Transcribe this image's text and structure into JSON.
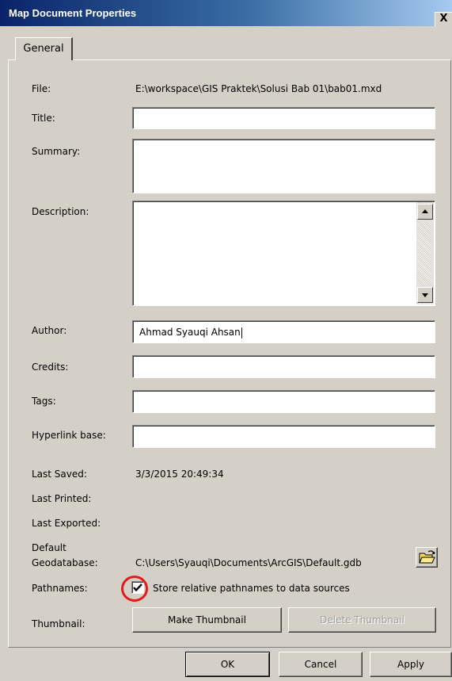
{
  "window": {
    "title": "Map Document Properties",
    "close_label": "X"
  },
  "tabs": [
    {
      "label": "General"
    }
  ],
  "form": {
    "file_label": "File:",
    "file_value": "E:\\workspace\\GIS Praktek\\Solusi Bab 01\\bab01.mxd",
    "title_label": "Title:",
    "title_value": "",
    "summary_label": "Summary:",
    "summary_value": "",
    "description_label": "Description:",
    "description_value": "",
    "author_label": "Author:",
    "author_value": "Ahmad Syauqi Ahsan",
    "credits_label": "Credits:",
    "credits_value": "",
    "tags_label": "Tags:",
    "tags_value": "",
    "hyperlink_label": "Hyperlink base:",
    "hyperlink_value": "",
    "last_saved_label": "Last Saved:",
    "last_saved_value": "3/3/2015 20:49:34",
    "last_printed_label": "Last Printed:",
    "last_exported_label": "Last Exported:",
    "default_gdb_label_line1": "Default",
    "default_gdb_label_line2": "Geodatabase:",
    "default_gdb_value": "C:\\Users\\Syauqi\\Documents\\ArcGIS\\Default.gdb",
    "pathnames_label": "Pathnames:",
    "pathnames_checkbox_label": "Store relative pathnames to data sources",
    "pathnames_checked": true,
    "thumbnail_label": "Thumbnail:",
    "make_thumbnail_label": "Make Thumbnail",
    "delete_thumbnail_label": "Delete Thumbnail"
  },
  "footer": {
    "ok_label": "OK",
    "cancel_label": "Cancel",
    "apply_label": "Apply"
  },
  "colors": {
    "titlebar_start": "#0a246a",
    "titlebar_end": "#a6caf0",
    "dialog_bg": "#d4d0c8",
    "highlight_circle": "#e51a1a"
  },
  "icons": {
    "close": "close-icon",
    "scroll_up": "scroll-up-arrow-icon",
    "scroll_down": "scroll-down-arrow-icon",
    "browse": "open-folder-icon",
    "check": "check-icon"
  }
}
